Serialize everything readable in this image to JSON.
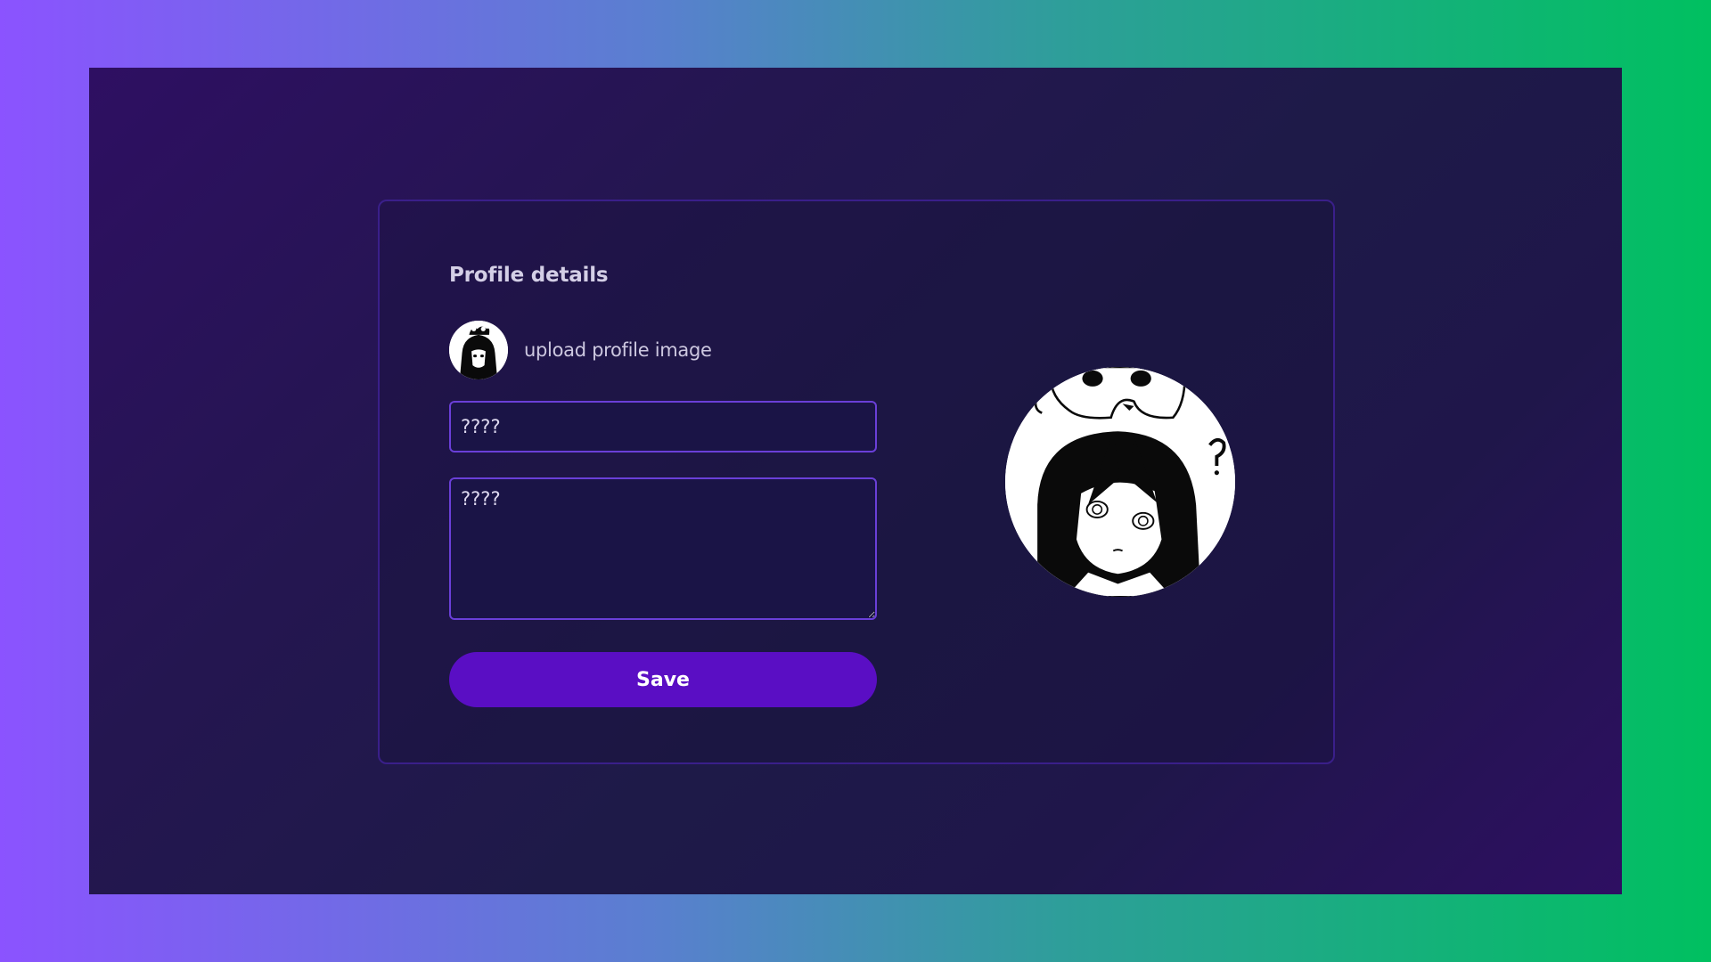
{
  "profile": {
    "title": "Profile details",
    "upload_label": "upload profile image",
    "name_field": {
      "placeholder": "????"
    },
    "bio_field": {
      "placeholder": "????"
    },
    "save_label": "Save",
    "avatar_icon": "profile-avatar-image"
  },
  "colors": {
    "outer_gradient_left": "#8b53ff",
    "outer_gradient_right": "#00c060",
    "stage_background": "#231650",
    "card_border": "#3a1f8a",
    "field_border": "#6a3fd8",
    "button_background": "#5a0ec4"
  }
}
